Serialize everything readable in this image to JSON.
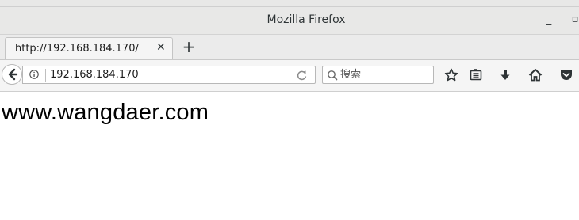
{
  "window": {
    "title": "Mozilla Firefox",
    "minimize_glyph": "_",
    "maximize_glyph": "▫"
  },
  "tabs": [
    {
      "label": "http://192.168.184.170/",
      "close_glyph": "✕"
    }
  ],
  "new_tab_glyph": "+",
  "navbar": {
    "url": "192.168.184.170",
    "search_placeholder": "搜索",
    "icons": [
      "back-arrow-icon",
      "info-icon",
      "reload-icon",
      "search-icon",
      "bookmark-star-icon",
      "reading-list-icon",
      "download-icon",
      "home-icon",
      "pocket-icon"
    ]
  },
  "page": {
    "heading": "www.wangdaer.com"
  }
}
